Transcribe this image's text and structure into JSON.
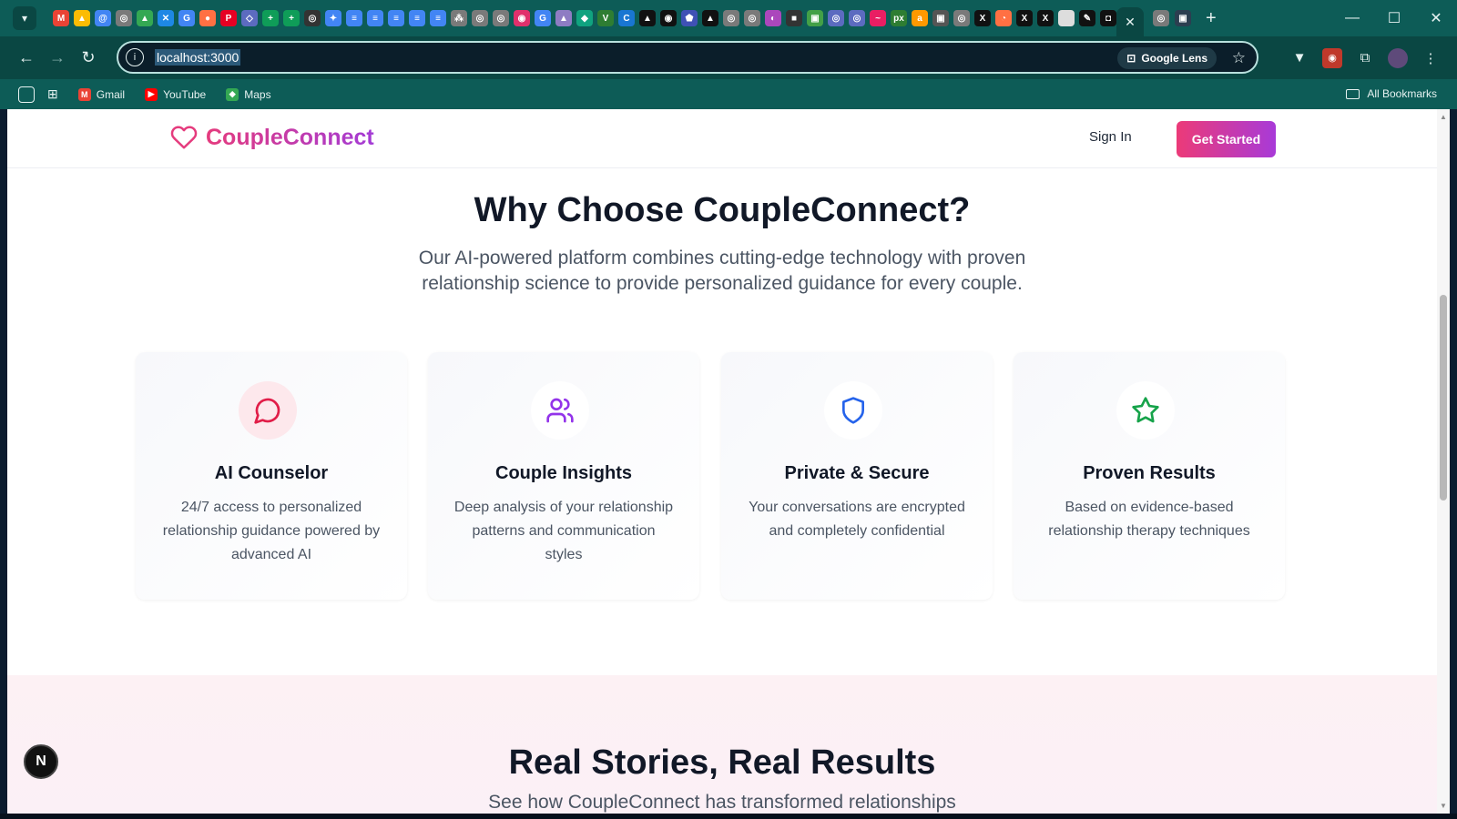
{
  "browser": {
    "url": "localhost:3000",
    "lens_label": "Google Lens",
    "bookmarks": [
      {
        "label": "Gmail",
        "color": "#ea4335",
        "glyph": "M"
      },
      {
        "label": "YouTube",
        "color": "#ff0000",
        "glyph": "▶"
      },
      {
        "label": "Maps",
        "color": "#34a853",
        "glyph": "◆"
      }
    ],
    "all_bookmarks_label": "All Bookmarks",
    "tab_favicons": [
      {
        "color": "#ea4335",
        "glyph": "M"
      },
      {
        "color": "#fbbc04",
        "glyph": "▲"
      },
      {
        "color": "#4285f4",
        "glyph": "@"
      },
      {
        "color": "#7a7a7a",
        "glyph": "◎"
      },
      {
        "color": "#34a853",
        "glyph": "▲"
      },
      {
        "color": "#1e88e5",
        "glyph": "✕"
      },
      {
        "color": "#4285f4",
        "glyph": "G"
      },
      {
        "color": "#ff7043",
        "glyph": "●"
      },
      {
        "color": "#e60023",
        "glyph": "P"
      },
      {
        "color": "#5c6bc0",
        "glyph": "◇"
      },
      {
        "color": "#0f9d58",
        "glyph": "+"
      },
      {
        "color": "#0f9d58",
        "glyph": "+"
      },
      {
        "color": "#333333",
        "glyph": "◎"
      },
      {
        "color": "#4285f4",
        "glyph": "✦"
      },
      {
        "color": "#4285f4",
        "glyph": "≡"
      },
      {
        "color": "#4285f4",
        "glyph": "≡"
      },
      {
        "color": "#4285f4",
        "glyph": "≡"
      },
      {
        "color": "#4285f4",
        "glyph": "≡"
      },
      {
        "color": "#4285f4",
        "glyph": "≡"
      },
      {
        "color": "#7a7a7a",
        "glyph": "⁂"
      },
      {
        "color": "#7a7a7a",
        "glyph": "◎"
      },
      {
        "color": "#7a7a7a",
        "glyph": "◎"
      },
      {
        "color": "#e1306c",
        "glyph": "◉"
      },
      {
        "color": "#4285f4",
        "glyph": "G"
      },
      {
        "color": "#8e7cc3",
        "glyph": "▲"
      },
      {
        "color": "#10a37f",
        "glyph": "◆"
      },
      {
        "color": "#2e7d32",
        "glyph": "V"
      },
      {
        "color": "#1976d2",
        "glyph": "C"
      },
      {
        "color": "#111111",
        "glyph": "▲"
      },
      {
        "color": "#111111",
        "glyph": "◉"
      },
      {
        "color": "#3f51b5",
        "glyph": "⬟"
      },
      {
        "color": "#111111",
        "glyph": "▲"
      },
      {
        "color": "#7a7a7a",
        "glyph": "◎"
      },
      {
        "color": "#7a7a7a",
        "glyph": "◎"
      },
      {
        "color": "#ab47bc",
        "glyph": "◐"
      },
      {
        "color": "#333333",
        "glyph": "■"
      },
      {
        "color": "#43a047",
        "glyph": "▣"
      },
      {
        "color": "#5c6bc0",
        "glyph": "◎"
      },
      {
        "color": "#5c6bc0",
        "glyph": "◎"
      },
      {
        "color": "#e91e63",
        "glyph": "~"
      },
      {
        "color": "#2e7d32",
        "glyph": "px"
      },
      {
        "color": "#ff9900",
        "glyph": "a"
      },
      {
        "color": "#555555",
        "glyph": "▣"
      },
      {
        "color": "#7a7a7a",
        "glyph": "◎"
      },
      {
        "color": "#111111",
        "glyph": "X"
      },
      {
        "color": "#ff7043",
        "glyph": "◔"
      },
      {
        "color": "#111111",
        "glyph": "X"
      },
      {
        "color": "#111111",
        "glyph": "X"
      },
      {
        "color": "#dddddd",
        "glyph": " "
      },
      {
        "color": "#111111",
        "glyph": "✎"
      },
      {
        "color": "#111111",
        "glyph": "◘"
      }
    ]
  },
  "site": {
    "brand": "CoupleConnect",
    "nav": {
      "signin": "Sign In",
      "cta": "Get Started"
    },
    "why": {
      "title": "Why Choose CoupleConnect?",
      "subtitle": "Our AI-powered platform combines cutting-edge technology with proven relationship science to provide personalized guidance for every couple."
    },
    "features": [
      {
        "title": "AI Counselor",
        "desc": "24/7 access to personalized relationship guidance powered by advanced AI",
        "icon": "message-circle-icon",
        "color": "#e11d48",
        "bg": "#fde8ec"
      },
      {
        "title": "Couple Insights",
        "desc": "Deep analysis of your relationship patterns and communication styles",
        "icon": "users-icon",
        "color": "#9333ea",
        "bg": "#ffffff"
      },
      {
        "title": "Private & Secure",
        "desc": "Your conversations are encrypted and completely confidential",
        "icon": "shield-icon",
        "color": "#2563eb",
        "bg": "#ffffff"
      },
      {
        "title": "Proven Results",
        "desc": "Based on evidence-based relationship therapy techniques",
        "icon": "star-icon",
        "color": "#16a34a",
        "bg": "#ffffff"
      }
    ],
    "stories": {
      "title": "Real Stories, Real Results",
      "subtitle": "See how CoupleConnect has transformed relationships"
    }
  },
  "devtools": {
    "badge": "N"
  }
}
